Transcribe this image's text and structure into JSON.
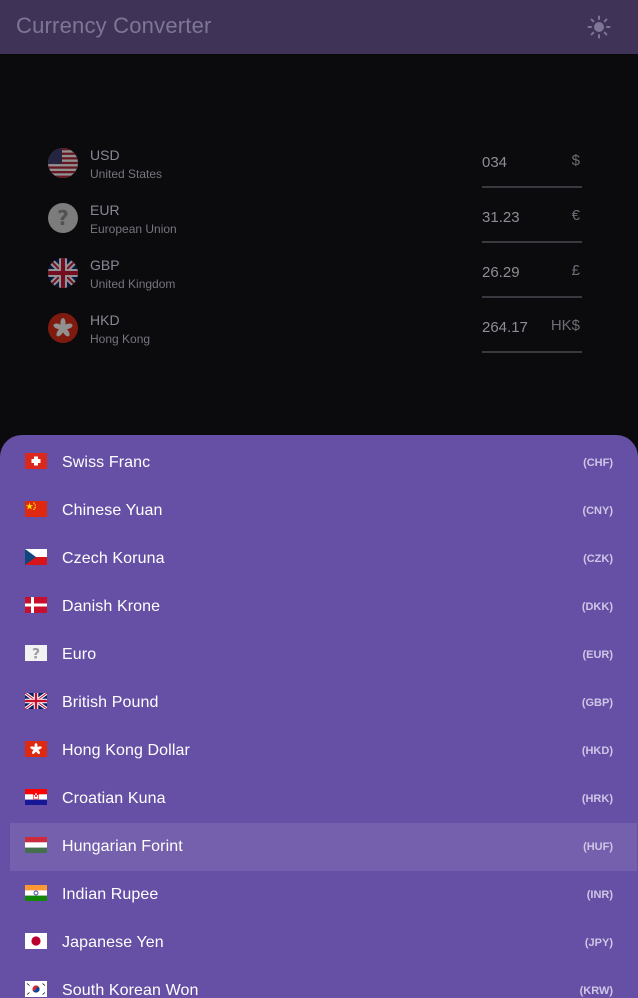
{
  "app": {
    "title": "Currency Converter"
  },
  "converter_rows": [
    {
      "code": "USD",
      "country": "United States",
      "amount": "034",
      "symbol": "$"
    },
    {
      "code": "EUR",
      "country": "European Union",
      "amount": "31.23",
      "symbol": "€"
    },
    {
      "code": "GBP",
      "country": "United Kingdom",
      "amount": "26.29",
      "symbol": "£"
    },
    {
      "code": "HKD",
      "country": "Hong Kong",
      "amount": "264.17",
      "symbol": "HK$"
    }
  ],
  "currency_list": [
    {
      "name": "Swiss Franc",
      "code": "(CHF)"
    },
    {
      "name": "Chinese Yuan",
      "code": "(CNY)"
    },
    {
      "name": "Czech Koruna",
      "code": "(CZK)"
    },
    {
      "name": "Danish Krone",
      "code": "(DKK)"
    },
    {
      "name": "Euro",
      "code": "(EUR)"
    },
    {
      "name": "British Pound",
      "code": "(GBP)"
    },
    {
      "name": "Hong Kong Dollar",
      "code": "(HKD)"
    },
    {
      "name": "Croatian Kuna",
      "code": "(HRK)"
    },
    {
      "name": "Hungarian Forint",
      "code": "(HUF)"
    },
    {
      "name": "Indian Rupee",
      "code": "(INR)"
    },
    {
      "name": "Japanese Yen",
      "code": "(JPY)"
    },
    {
      "name": "South Korean Won",
      "code": "(KRW)"
    }
  ],
  "selected_currency": "Hungarian Forint",
  "colors": {
    "topbar": "#3f3458",
    "sheet": "#6650a5",
    "selected_row": "#7460ad"
  }
}
